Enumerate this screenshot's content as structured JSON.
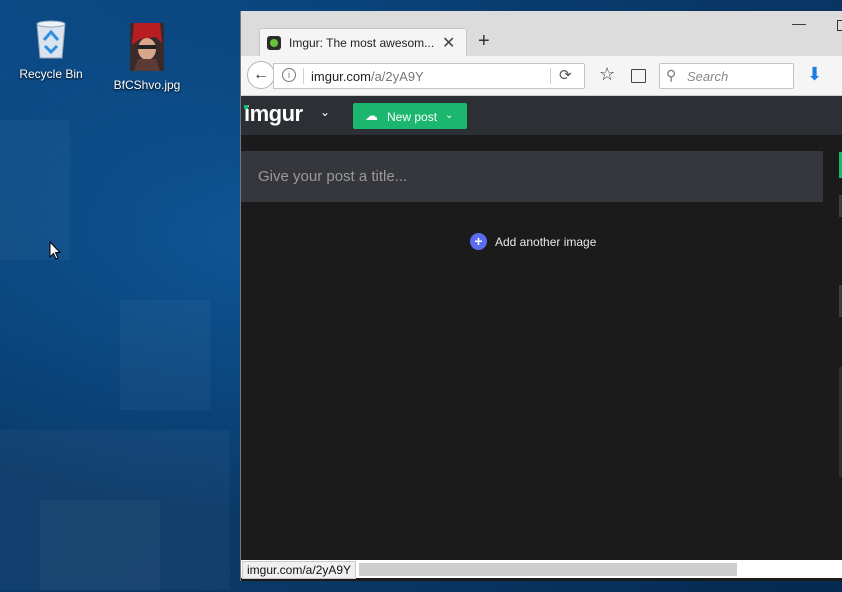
{
  "desktop": {
    "icons": [
      {
        "label": "Recycle Bin",
        "icon": "recycle-bin-icon"
      },
      {
        "label": "BfCShvo.jpg",
        "icon": "image-file-icon"
      }
    ]
  },
  "browser": {
    "tab": {
      "title": "Imgur: The most awesom...",
      "favicon": "imgur-favicon-icon"
    },
    "address_bar": {
      "host": "imgur.com",
      "path": "/a/2yA9Y"
    },
    "search": {
      "placeholder": "Search"
    },
    "status_url": "imgur.com/a/2yA9Y"
  },
  "imgur": {
    "logo": "imgur",
    "new_post_label": "New post",
    "title_placeholder": "Give your post a title...",
    "add_image_label": "Add another image"
  },
  "colors": {
    "imgur_green": "#1bb76e",
    "add_button_blue": "#5c6cf0",
    "header_bg": "#2c2f34",
    "page_bg": "#1b1b1c",
    "download_blue": "#1a7ee2"
  }
}
